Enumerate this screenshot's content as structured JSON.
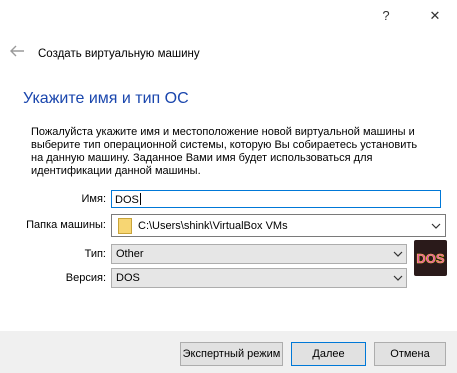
{
  "window": {
    "help_icon": "?",
    "close_icon": "✕"
  },
  "wizard": {
    "title": "Создать виртуальную машину",
    "heading": "Укажите имя и тип ОС",
    "description": "Пожалуйста укажите имя и местоположение новой виртуальной машины и выберите тип операционной системы, которую Вы собираетесь установить на данную машину. Заданное Вами имя будет использоваться для идентификации данной машины."
  },
  "form": {
    "name_label": "Имя:",
    "name_value": "DOS",
    "folder_label": "Папка машины:",
    "folder_value": "C:\\Users\\shink\\VirtualBox VMs",
    "type_label": "Тип:",
    "type_value": "Other",
    "version_label": "Версия:",
    "version_value": "DOS",
    "os_icon_text": "DOS"
  },
  "buttons": {
    "expert": "Экспертный режим",
    "next": "Далее",
    "cancel": "Отмена"
  },
  "colors": {
    "heading": "#1a46ad",
    "focus_border": "#0078d7",
    "footer_bg": "#f0f0f0"
  }
}
